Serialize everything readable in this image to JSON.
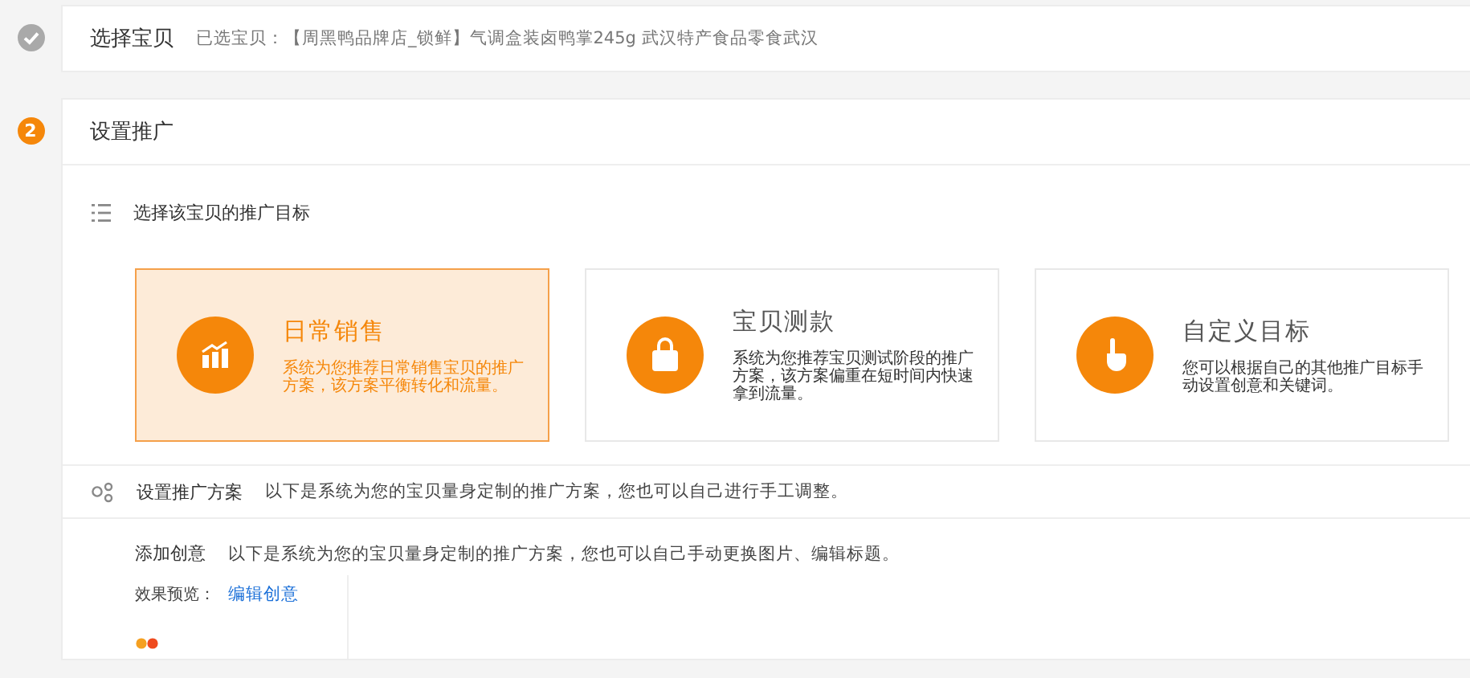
{
  "steps": [
    {
      "marker": {
        "kind": "done"
      },
      "title": "选择宝贝",
      "summary": "已选宝贝：【周黑鸭品牌店_锁鲜】气调盒装卤鸭掌245g 武汉特产食品零食武汉"
    },
    {
      "marker": {
        "kind": "number",
        "label": "2"
      },
      "title": "设置推广"
    }
  ],
  "goal_section": {
    "title": "选择该宝贝的推广目标",
    "goals": [
      {
        "title": "日常销售",
        "description": "系统为您推荐日常销售宝贝的推广方案，该方案平衡转化和流量。",
        "selected": true
      },
      {
        "title": "宝贝测款",
        "description": "系统为您推荐宝贝测试阶段的推广方案，该方案偏重在短时间内快速拿到流量。",
        "selected": false
      },
      {
        "title": "自定义目标",
        "description": "您可以根据自己的其他推广目标手动设置创意和关键词。",
        "selected": false
      }
    ]
  },
  "plan_section": {
    "title": "设置推广方案",
    "note": "以下是系统为您的宝贝量身定制的推广方案，您也可以自己进行手工调整。"
  },
  "creative": {
    "title": "添加创意",
    "note": "以下是系统为您的宝贝量身定制的推广方案，您也可以自己手动更换图片、编辑标题。",
    "preview_label": "效果预览：",
    "edit_link": "编辑创意"
  }
}
